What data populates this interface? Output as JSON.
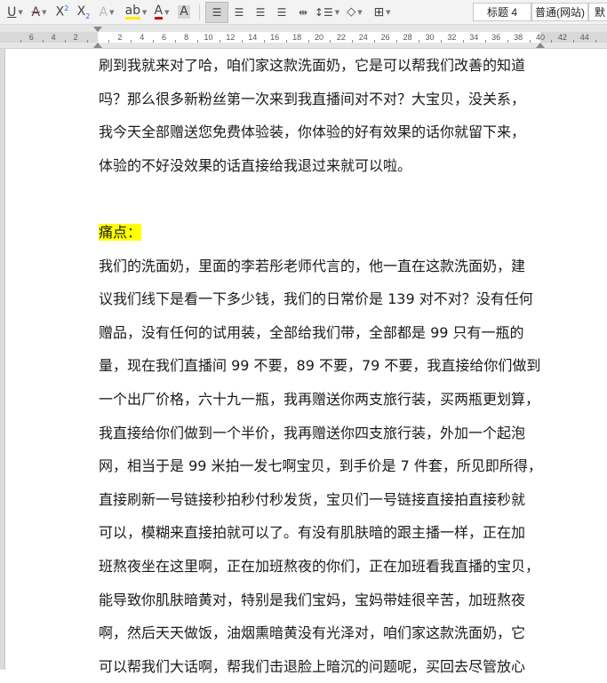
{
  "toolbar": {
    "style_heading4": "标题 4",
    "style_normal_web": "普通(网站)",
    "style_default": "默"
  },
  "ruler": {
    "left_labels": [
      "6",
      "4",
      "2"
    ],
    "labels": [
      "2",
      "4",
      "6",
      "8",
      "10",
      "12",
      "14",
      "16",
      "18",
      "20",
      "22",
      "24",
      "26",
      "28",
      "30",
      "32",
      "34",
      "36",
      "38"
    ],
    "right_labels": [
      "40",
      "42",
      "44"
    ]
  },
  "document": {
    "paragraph1_lines": [
      "刷到我就来对了哈，咱们家这款洗面奶，它是可以帮我们改善的知道",
      "吗？那么很多新粉丝第一次来到我直播间对不对？大宝贝，没关系，",
      "我今天全部赠送您免费体验装，你体验的好有效果的话你就留下来，",
      "体验的不好没效果的话直接给我退过来就可以啦。"
    ],
    "heading": "痛点：",
    "paragraph2_lines": [
      "我们的洗面奶，里面的李若彤老师代言的，他一直在这款洗面奶，建",
      "议我们线下是看一下多少钱，我们的日常价是 139 对不对？没有任何",
      "赠品，没有任何的试用装，全部给我们带，全部都是 99 只有一瓶的",
      "量，现在我们直播间 99 不要，89 不要，79 不要，我直接给你们做到",
      "一个出厂价格，六十九一瓶，我再赠送你两支旅行装，买两瓶更划算，",
      "我直接给你们做到一个半价，我再赠送你四支旅行装，外加一个起泡",
      "网，相当于是 99 米拍一发七啊宝贝，到手价是 7 件套，所见即所得，",
      "直接刷新一号链接秒拍秒付秒发货，宝贝们一号链接直接拍直接秒就",
      "可以，模糊来直接拍就可以了。有没有肌肤暗的跟主播一样，正在加",
      "班熬夜坐在这里啊，正在加班熬夜的你们，正在加班看我直播的宝贝，",
      "能导致你肌肤暗黄对，特别是我们宝妈，宝妈带娃很辛苦，加班熬夜",
      "啊，然后天天做饭，油烟熏暗黄没有光泽对，咱们家这款洗面奶，它",
      "可以帮我们大话啊，帮我们击退脸上暗沉的问题呢，买回去尽管放心"
    ]
  }
}
